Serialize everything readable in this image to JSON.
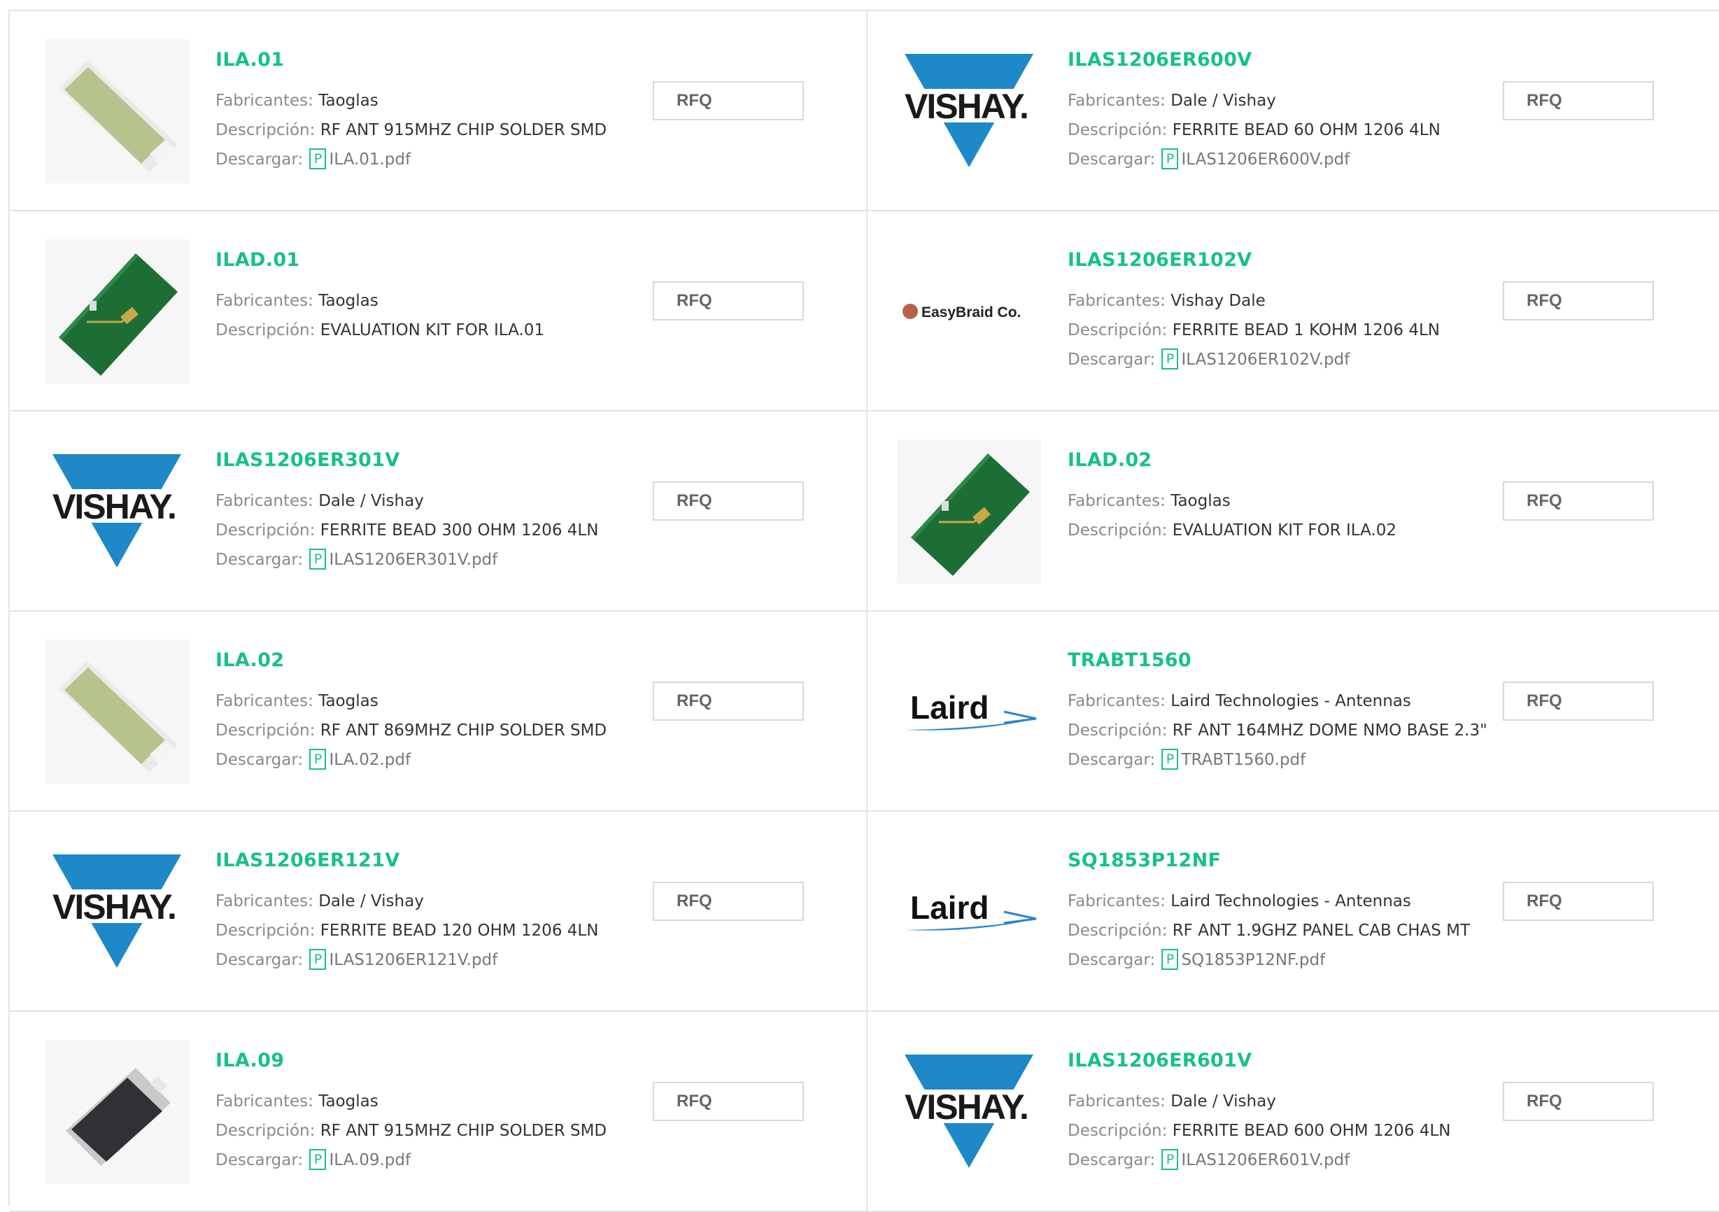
{
  "labels": {
    "manufacturer": "Fabricantes:",
    "description": "Descripción:",
    "download": "Descargar:",
    "rfq": "RFQ",
    "pdf_icon": "P"
  },
  "brand_colors": {
    "link_green": "#17c08a",
    "vishay_blue": "#1e88c8",
    "laird_blue": "#2a84cf"
  },
  "products": [
    {
      "part": "ILA.01",
      "manufacturer": "Taoglas",
      "description": "RF ANT 915MHZ CHIP SOLDER SMD",
      "download": "ILA.01.pdf",
      "image": "chip-antenna-green"
    },
    {
      "part": "ILAS1206ER600V",
      "manufacturer": "Dale / Vishay",
      "description": "FERRITE BEAD 60 OHM 1206 4LN",
      "download": "ILAS1206ER600V.pdf",
      "image": "vishay-logo",
      "logo_text": "VISHAY."
    },
    {
      "part": "ILAD.01",
      "manufacturer": "Taoglas",
      "description": "EVALUATION KIT FOR ILA.01",
      "download": null,
      "image": "eval-board"
    },
    {
      "part": "ILAS1206ER102V",
      "manufacturer": "Vishay Dale",
      "description": "FERRITE BEAD 1 KOHM 1206 4LN",
      "download": "ILAS1206ER102V.pdf",
      "image": "easybraid-logo",
      "logo_text": "EasyBraid Co."
    },
    {
      "part": "ILAS1206ER301V",
      "manufacturer": "Dale / Vishay",
      "description": "FERRITE BEAD 300 OHM 1206 4LN",
      "download": "ILAS1206ER301V.pdf",
      "image": "vishay-logo",
      "logo_text": "VISHAY."
    },
    {
      "part": "ILAD.02",
      "manufacturer": "Taoglas",
      "description": "EVALUATION KIT FOR ILA.02",
      "download": null,
      "image": "eval-board"
    },
    {
      "part": "ILA.02",
      "manufacturer": "Taoglas",
      "description": "RF ANT 869MHZ CHIP SOLDER SMD",
      "download": "ILA.02.pdf",
      "image": "chip-antenna-green"
    },
    {
      "part": "TRABT1560",
      "manufacturer": "Laird Technologies - Antennas",
      "description": "RF ANT 164MHZ DOME NMO BASE 2.3\"",
      "download": "TRABT1560.pdf",
      "image": "laird-logo",
      "logo_text": "Laird"
    },
    {
      "part": "ILAS1206ER121V",
      "manufacturer": "Dale / Vishay",
      "description": "FERRITE BEAD 120 OHM 1206 4LN",
      "download": "ILAS1206ER121V.pdf",
      "image": "vishay-logo",
      "logo_text": "VISHAY."
    },
    {
      "part": "SQ1853P12NF",
      "manufacturer": "Laird Technologies - Antennas",
      "description": "RF ANT 1.9GHZ PANEL CAB CHAS MT",
      "download": "SQ1853P12NF.pdf",
      "image": "laird-logo",
      "logo_text": "Laird"
    },
    {
      "part": "ILA.09",
      "manufacturer": "Taoglas",
      "description": "RF ANT 915MHZ CHIP SOLDER SMD",
      "download": "ILA.09.pdf",
      "image": "chip-antenna-dark"
    },
    {
      "part": "ILAS1206ER601V",
      "manufacturer": "Dale / Vishay",
      "description": "FERRITE BEAD 600 OHM 1206 4LN",
      "download": "ILAS1206ER601V.pdf",
      "image": "vishay-logo",
      "logo_text": "VISHAY."
    }
  ]
}
